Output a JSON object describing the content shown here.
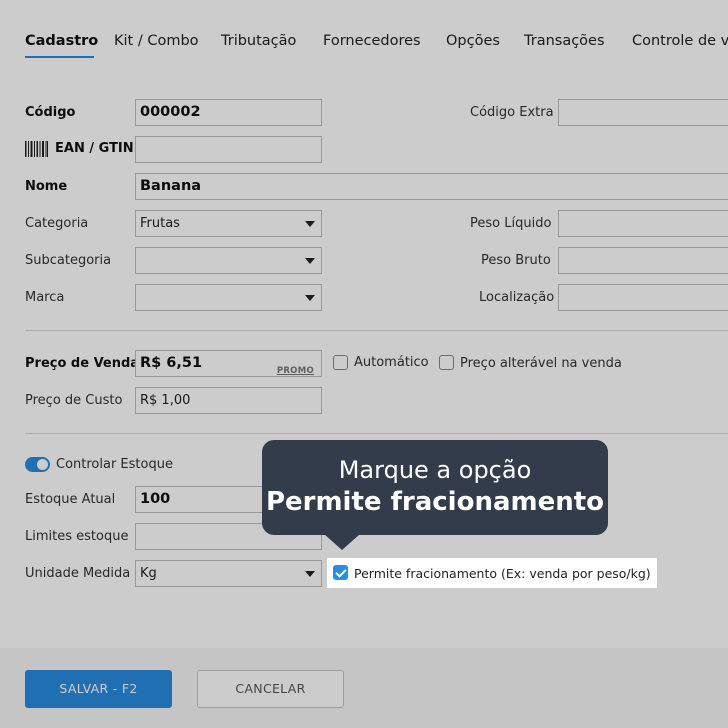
{
  "tabs": [
    {
      "label": "Cadastro",
      "active": true
    },
    {
      "label": "Kit / Combo",
      "active": false
    },
    {
      "label": "Tributação",
      "active": false
    },
    {
      "label": "Fornecedores",
      "active": false
    },
    {
      "label": "Opções",
      "active": false
    },
    {
      "label": "Transações",
      "active": false
    },
    {
      "label": "Controle de v",
      "active": false
    }
  ],
  "form": {
    "codigo": {
      "label": "Código",
      "value": "000002"
    },
    "codigo_extra": {
      "label": "Código Extra",
      "value": ""
    },
    "ean": {
      "label": "EAN / GTIN",
      "value": ""
    },
    "nome": {
      "label": "Nome",
      "value": "Banana"
    },
    "categoria": {
      "label": "Categoria",
      "value": "Frutas"
    },
    "peso_liquido": {
      "label": "Peso Líquido",
      "value": ""
    },
    "subcategoria": {
      "label": "Subcategoria",
      "value": ""
    },
    "peso_bruto": {
      "label": "Peso Bruto",
      "value": ""
    },
    "marca": {
      "label": "Marca",
      "value": ""
    },
    "localizacao": {
      "label": "Localização",
      "value": ""
    },
    "preco_venda": {
      "label": "Preço de Venda",
      "value": "R$ 6,51",
      "promo": "PROMO"
    },
    "automatico": {
      "label": "Automático",
      "checked": false
    },
    "preco_alteravel": {
      "label": "Preço alterável na venda",
      "checked": false
    },
    "preco_custo": {
      "label": "Preço de Custo",
      "value": "R$ 1,00"
    },
    "controlar_estoque": {
      "label": "Controlar Estoque",
      "on": true
    },
    "estoque_atual": {
      "label": "Estoque Atual",
      "value": "100"
    },
    "limites_estoque": {
      "label": "Limites estoque",
      "value": ""
    },
    "unidade_medida": {
      "label": "Unidade Medida",
      "value": "Kg"
    },
    "permite_fracionamento": {
      "label": "Permite fracionamento (Ex: venda por peso/kg)",
      "checked": true
    }
  },
  "tooltip": {
    "line1": "Marque a opção",
    "line2": "Permite fracionamento"
  },
  "buttons": {
    "save": "SALVAR - F2",
    "cancel": "CANCELAR"
  },
  "colors": {
    "accent": "#2a8be0",
    "tooltip_bg": "#333c4a"
  }
}
